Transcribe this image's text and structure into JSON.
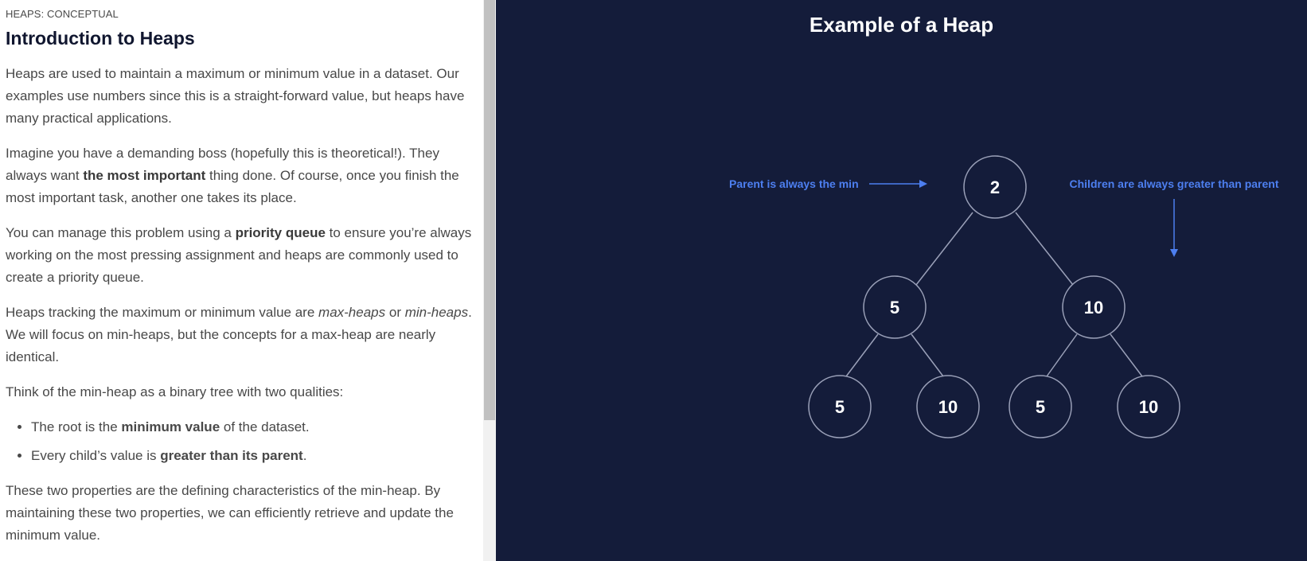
{
  "lesson": {
    "eyebrow": "HEAPS: CONCEPTUAL",
    "title": "Introduction to Heaps",
    "p1": "Heaps are used to maintain a maximum or minimum value in a dataset. Our examples use numbers since this is a straight-forward value, but heaps have many practical applications.",
    "p2_a": "Imagine you have a demanding boss (hopefully this is theoretical!). They always want ",
    "p2_b": "the most important",
    "p2_c": " thing done. Of course, once you finish the most important task, another one takes its place.",
    "p3_a": "You can manage this problem using a ",
    "p3_b": "priority queue",
    "p3_c": " to ensure you’re always working on the most pressing assignment and heaps are commonly used to create a priority queue.",
    "p4_a": "Heaps tracking the maximum or minimum value are ",
    "p4_b": "max-heaps",
    "p4_c": " or ",
    "p4_d": "min-heaps",
    "p4_e": ". We will focus on min-heaps, but the concepts for a max-heap are nearly identical.",
    "p5": "Think of the min-heap as a binary tree with two qualities:",
    "b1_a": "The root is the ",
    "b1_b": "minimum value",
    "b1_c": " of the dataset.",
    "b2_a": "Every child’s value is ",
    "b2_b": "greater than its parent",
    "b2_c": ".",
    "p6": "These two properties are the defining characteristics of the min-heap. By maintaining these two properties, we can efficiently retrieve and update the minimum value."
  },
  "diagram": {
    "title": "Example of a Heap",
    "annotation_left": "Parent is always the min",
    "annotation_right": "Children are always greater than parent",
    "nodes": {
      "root": "2",
      "left": "5",
      "right": "10",
      "left_left": "5",
      "left_right": "10",
      "right_left": "5",
      "right_right": "10"
    },
    "colors": {
      "background": "#141c3a",
      "node_stroke": "#9aa0b8",
      "annotation": "#4d7ff0"
    }
  }
}
